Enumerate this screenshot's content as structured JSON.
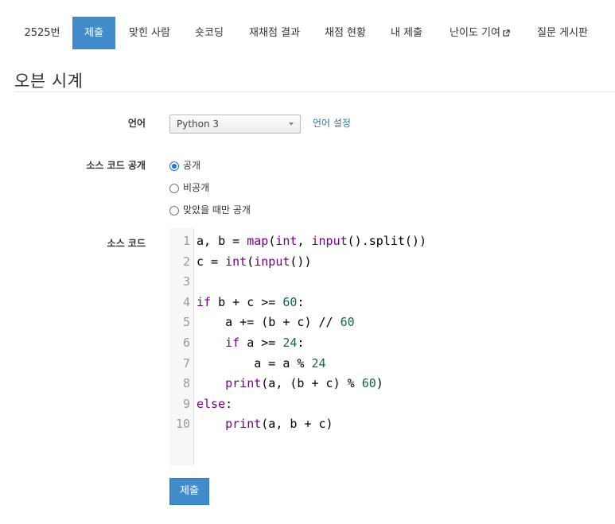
{
  "tabs": [
    {
      "label": "2525번"
    },
    {
      "label": "제출"
    },
    {
      "label": "맞힌 사람"
    },
    {
      "label": "숏코딩"
    },
    {
      "label": "재채점 결과"
    },
    {
      "label": "채점 현황"
    },
    {
      "label": "내 제출"
    },
    {
      "label": "난이도 기여"
    },
    {
      "label": "질문 게시판"
    }
  ],
  "active_tab": "제출",
  "page_title": "오븐 시계",
  "form": {
    "language_label": "언어",
    "language_value": "Python 3",
    "language_settings_link": "언어 설정",
    "visibility_label": "소스 코드 공개",
    "visibility_options": [
      {
        "label": "공개",
        "checked": true
      },
      {
        "label": "비공개",
        "checked": false
      },
      {
        "label": "맞았을 때만 공개",
        "checked": false
      }
    ],
    "source_label": "소스 코드",
    "submit_label": "제출"
  },
  "code": {
    "lines": [
      "a, b = map(int, input().split())",
      "c = int(input())",
      "",
      "if b + c >= 60:",
      "    a += (b + c) // 60",
      "    if a >= 24:",
      "        a = a % 24",
      "    print(a, (b + c) % 60)",
      "else:",
      "    print(a, b + c)"
    ]
  },
  "colors": {
    "primary": "#428bca",
    "link": "#2a7ab0",
    "keyword": "#770088",
    "number": "#116644"
  }
}
